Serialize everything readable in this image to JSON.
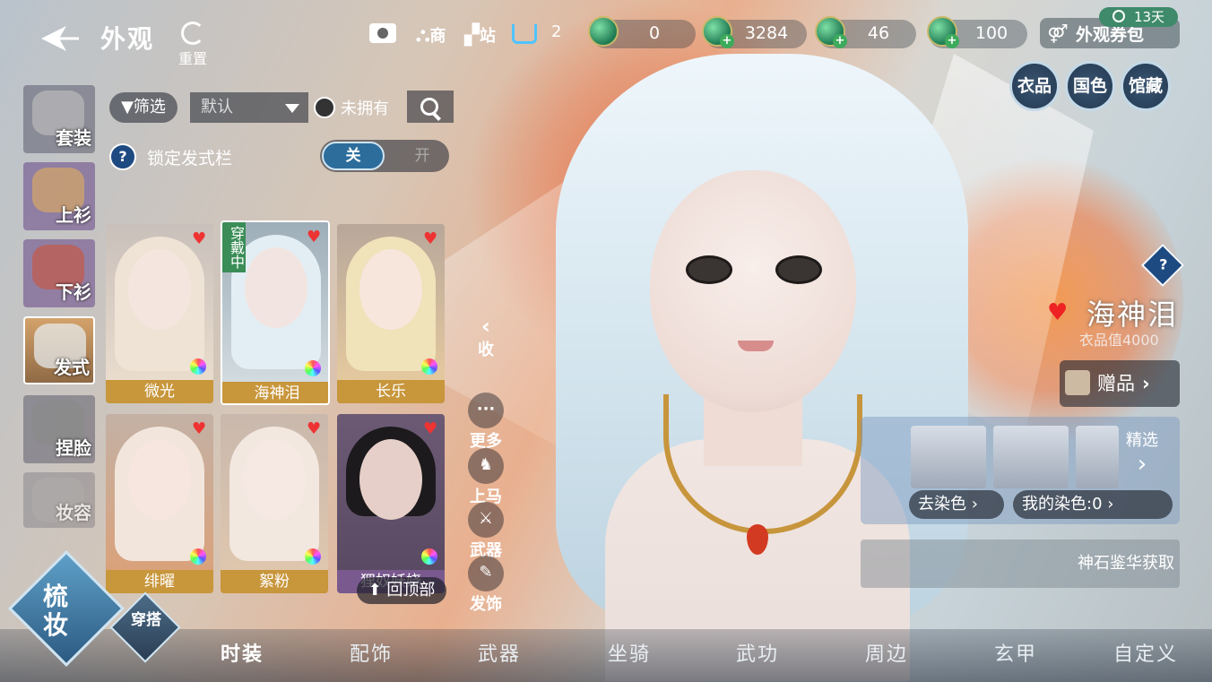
{
  "header": {
    "title": "外观",
    "reset_label": "重置",
    "shop_label": "商",
    "station_label": "站",
    "cart_count": "2",
    "currencies": [
      "0",
      "3284",
      "46",
      "100"
    ],
    "voucher_label": "外观券包",
    "voucher_days": "13天"
  },
  "categories": [
    {
      "label": "套装"
    },
    {
      "label": "上衫"
    },
    {
      "label": "下衫"
    },
    {
      "label": "发式"
    },
    {
      "label": "捏脸"
    },
    {
      "label": "妆容"
    }
  ],
  "filters": {
    "filter_label": "筛选",
    "sort_value": "默认",
    "not_owned_label": "未拥有",
    "lock_label": "锁定发式栏",
    "toggle_off": "关",
    "toggle_on": "开"
  },
  "hairstyles": [
    {
      "name": "微光"
    },
    {
      "name": "海神泪",
      "status": "穿戴中"
    },
    {
      "name": "长乐"
    },
    {
      "name": "绯曜"
    },
    {
      "name": "絮粉"
    },
    {
      "name": "狸奴妖娆"
    }
  ],
  "back_to_top": "回顶部",
  "side_actions": {
    "collapse": "收",
    "more": "更多",
    "mount": "上马",
    "weapon": "武器",
    "hair_accessory": "发饰"
  },
  "right_tabs": [
    "衣品",
    "国色",
    "馆藏"
  ],
  "item": {
    "name": "海神泪",
    "value": "衣品值4000",
    "gift_label": "赠品",
    "featured_label": "精选",
    "dye_label": "去染色",
    "my_dye_label": "我的染色:0",
    "source": "神石鉴华获取"
  },
  "corner": {
    "primary": "梳妆",
    "secondary": "穿搭"
  },
  "bottom_tabs": [
    "时装",
    "配饰",
    "武器",
    "坐骑",
    "武功",
    "周边",
    "玄甲",
    "自定义"
  ],
  "colors": {
    "accent_gold": "#c8963b",
    "wearing_green": "#3a8d57",
    "heart_red": "#e33333"
  }
}
